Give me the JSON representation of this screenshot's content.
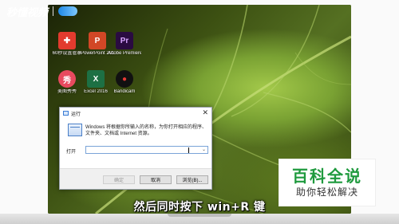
{
  "watermark": {
    "logo_text": "秒懂视频"
  },
  "desktop_icons": [
    {
      "label": "60秒设置管家",
      "glyph": "✚",
      "color": "#e23b2e",
      "icon": "shield-plus-icon"
    },
    {
      "label": "PowerPoint 2016",
      "glyph": "P",
      "color": "#d24726",
      "icon": "powerpoint-icon"
    },
    {
      "label": "Adobe Premiere...",
      "glyph": "Pr",
      "color": "#2a0b41",
      "icon": "premiere-icon"
    },
    {
      "label": "美图秀秀",
      "glyph": "秀",
      "color": "#e84a5f",
      "icon": "meitu-icon"
    },
    {
      "label": "Excel 2016",
      "glyph": "X",
      "color": "#1d7044",
      "icon": "excel-icon"
    },
    {
      "label": "Bandicam",
      "glyph": "●",
      "color": "#111111",
      "icon": "bandicam-icon"
    }
  ],
  "run_dialog": {
    "title": "运行",
    "close_glyph": "✕",
    "description": "Windows 将根据你所输入的名称，为你打开相应的程序、文件夹、文档或 Internet 资源。",
    "open_label": "打开",
    "input_value": "",
    "ok_label": "确定",
    "cancel_label": "取消",
    "browse_label": "浏览(B)..."
  },
  "subtitle": "然后同时按下 win+R 键",
  "badge": {
    "title": "百科全说",
    "subtitle": "助你轻松解决",
    "color": "#1f9a3e"
  }
}
